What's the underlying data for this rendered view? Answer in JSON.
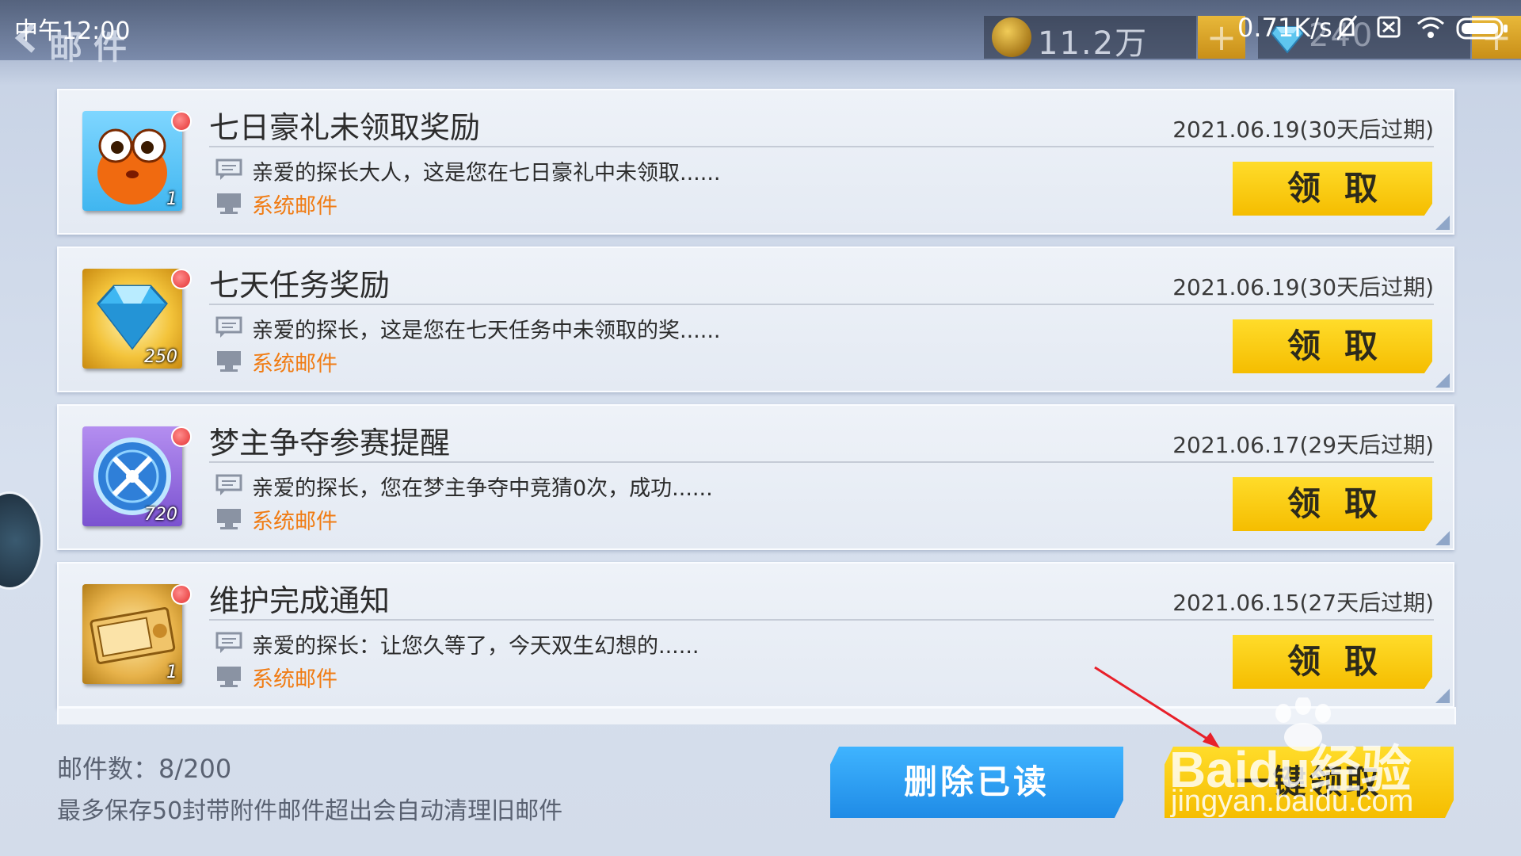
{
  "status_bar": {
    "time": "中午12:00",
    "net_speed": "0.71K/s"
  },
  "header": {
    "title": "邮件",
    "currency": {
      "gold": "11.2万",
      "gems": "240",
      "plus_label": "+"
    }
  },
  "mails": [
    {
      "title": "七日豪礼未领取奖励",
      "date": "2021.06.19(30天后过期)",
      "preview": "亲爱的探长大人，这是您在七日豪礼中未领取......",
      "sender": "系统邮件",
      "attachment_qty": "1",
      "attachment_icon": "orange-mascot-icon",
      "claim_label": "领取"
    },
    {
      "title": "七天任务奖励",
      "date": "2021.06.19(30天后过期)",
      "preview": "亲爱的探长，这是您在七天任务中未领取的奖......",
      "sender": "系统邮件",
      "attachment_qty": "250",
      "attachment_icon": "diamond-icon",
      "claim_label": "领取"
    },
    {
      "title": "梦主争夺参赛提醒",
      "date": "2021.06.17(29天后过期)",
      "preview": "亲爱的探长，您在梦主争夺中竞猜0次，成功......",
      "sender": "系统邮件",
      "attachment_qty": "720",
      "attachment_icon": "purple-coin-icon",
      "claim_label": "领取"
    },
    {
      "title": "维护完成通知",
      "date": "2021.06.15(27天后过期)",
      "preview": "亲爱的探长：让您久等了，今天双生幻想的......",
      "sender": "系统邮件",
      "attachment_qty": "1",
      "attachment_icon": "summon-ticket-icon",
      "claim_label": "领取"
    }
  ],
  "footer": {
    "mail_count": "邮件数：8/200",
    "note": "最多保存50封带附件邮件超出会自动清理旧邮件",
    "delete_read_label": "删除已读",
    "claim_all_label": "一键领取"
  },
  "watermark": {
    "line1": "Baidu经验",
    "line2": "jingyan.baidu.com"
  },
  "colors": {
    "claim_yellow": "#f5bd00",
    "delete_blue": "#1f8be6",
    "sender_orange": "#f07c14",
    "unread_red": "#e43232"
  }
}
